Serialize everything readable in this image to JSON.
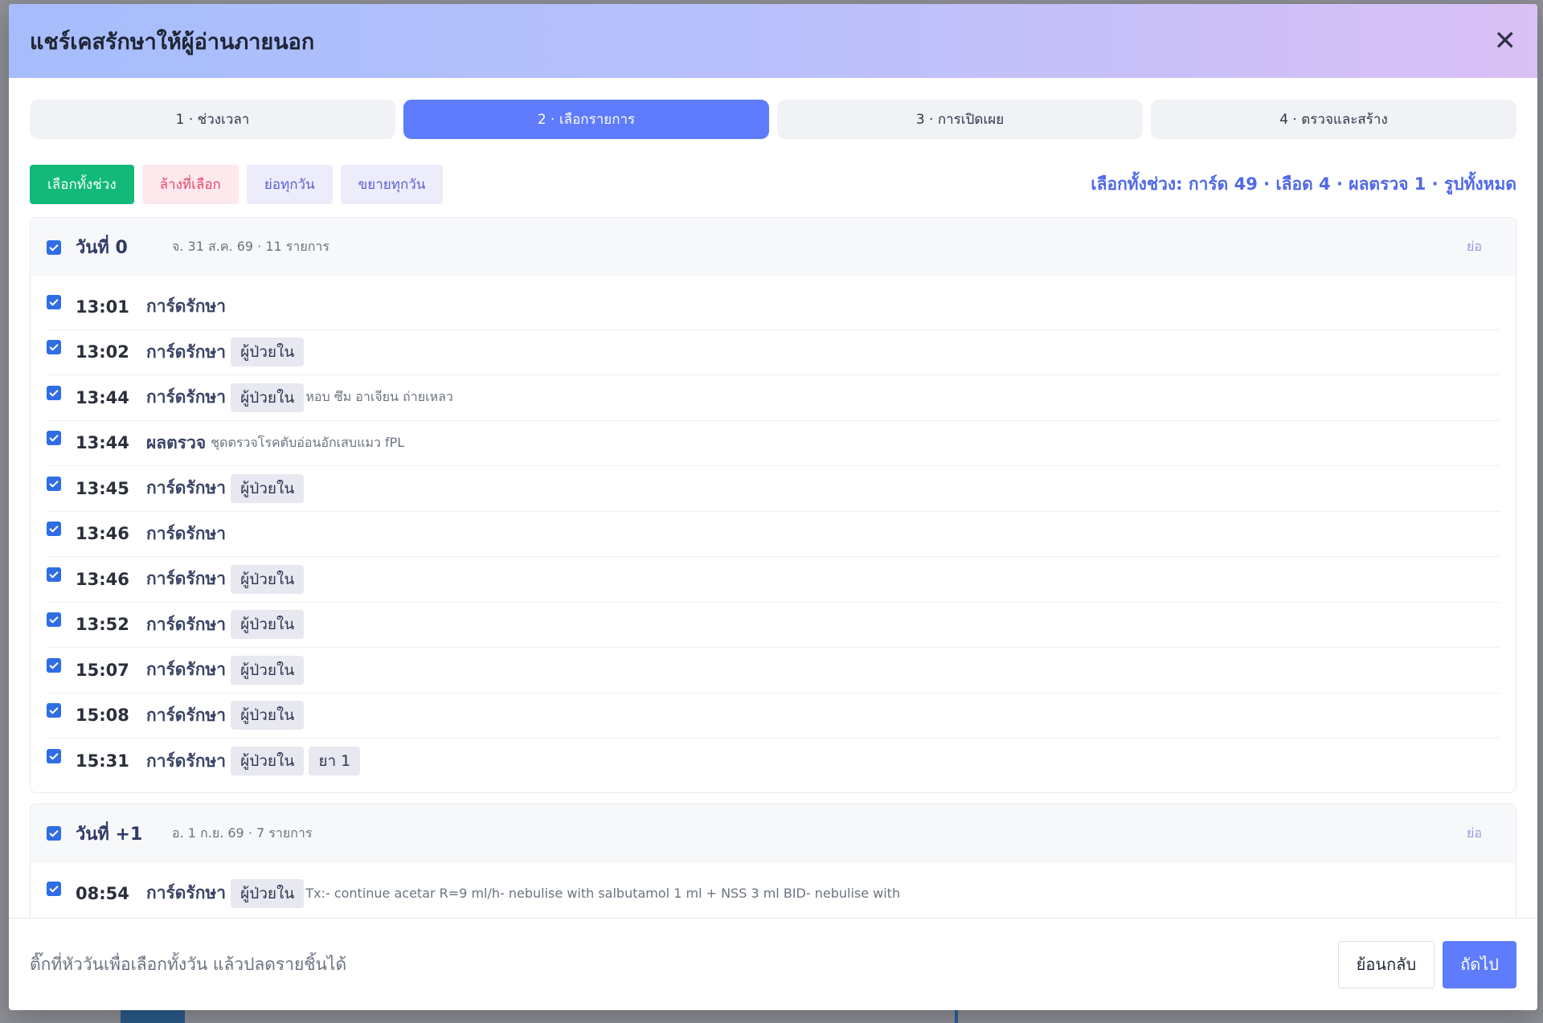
{
  "modal": {
    "title": "แชร์เคสรักษาให้ผู้อ่านภายนอก"
  },
  "steps": [
    {
      "label": "1 · ช่วงเวลา",
      "active": false
    },
    {
      "label": "2 · เลือกรายการ",
      "active": true
    },
    {
      "label": "3 · การเปิดเผย",
      "active": false
    },
    {
      "label": "4 · ตรวจและสร้าง",
      "active": false
    }
  ],
  "toolbar": {
    "select_all": "เลือกทั้งช่วง",
    "clear_selected": "ล้างที่เลือก",
    "collapse_all": "ย่อทุกวัน",
    "expand_all": "ขยายทุกวัน",
    "summary": "เลือกทั้งช่วง: การ์ด 49 · เลือด 4 · ผลตรวจ 1 · รูปทั้งหมด"
  },
  "days": [
    {
      "label": "วันที่ 0",
      "sub": "จ. 31 ส.ค. 69 · 11 รายการ",
      "toggle": "ย่อ",
      "checked": true,
      "entries": [
        {
          "time": "13:01",
          "kind": "การ์ดรักษา",
          "tags": [],
          "note": "",
          "checked": true
        },
        {
          "time": "13:02",
          "kind": "การ์ดรักษา",
          "tags": [
            "ผู้ป่วยใน"
          ],
          "note": "",
          "checked": true
        },
        {
          "time": "13:44",
          "kind": "การ์ดรักษา",
          "tags": [
            "ผู้ป่วยใน"
          ],
          "note": "หอบ ซึม อาเจียน ถ่ายเหลว",
          "checked": true
        },
        {
          "time": "13:44",
          "kind": "ผลตรวจ",
          "tags": [],
          "note": "ชุดตรวจโรคตับอ่อนอักเสบแมว fPL",
          "checked": true
        },
        {
          "time": "13:45",
          "kind": "การ์ดรักษา",
          "tags": [
            "ผู้ป่วยใน"
          ],
          "note": "",
          "checked": true
        },
        {
          "time": "13:46",
          "kind": "การ์ดรักษา",
          "tags": [],
          "note": "",
          "checked": true
        },
        {
          "time": "13:46",
          "kind": "การ์ดรักษา",
          "tags": [
            "ผู้ป่วยใน"
          ],
          "note": "",
          "checked": true
        },
        {
          "time": "13:52",
          "kind": "การ์ดรักษา",
          "tags": [
            "ผู้ป่วยใน"
          ],
          "note": "",
          "checked": true
        },
        {
          "time": "15:07",
          "kind": "การ์ดรักษา",
          "tags": [
            "ผู้ป่วยใน"
          ],
          "note": "",
          "checked": true
        },
        {
          "time": "15:08",
          "kind": "การ์ดรักษา",
          "tags": [
            "ผู้ป่วยใน"
          ],
          "note": "",
          "checked": true
        },
        {
          "time": "15:31",
          "kind": "การ์ดรักษา",
          "tags": [
            "ผู้ป่วยใน",
            "ยา 1"
          ],
          "note": "",
          "checked": true
        }
      ]
    },
    {
      "label": "วันที่ +1",
      "sub": "อ. 1 ก.ย. 69 · 7 รายการ",
      "toggle": "ย่อ",
      "checked": true,
      "entries": [
        {
          "time": "08:54",
          "kind": "การ์ดรักษา",
          "tags": [
            "ผู้ป่วยใน"
          ],
          "note": "Tx:- continue acetar R=9 ml/h- nebulise with salbutamol 1 ml + NSS 3 ml BID- nebulise with",
          "checked": true
        }
      ]
    }
  ],
  "footer": {
    "hint": "ติ๊กที่หัววันเพื่อเลือกทั้งวัน แล้วปลดรายชิ้นได้",
    "back": "ย้อนกลับ",
    "next": "ถัดไป"
  },
  "colors": {
    "accent": "#5e7cfb",
    "green": "#12b978",
    "checkbox": "#2e6de6"
  }
}
